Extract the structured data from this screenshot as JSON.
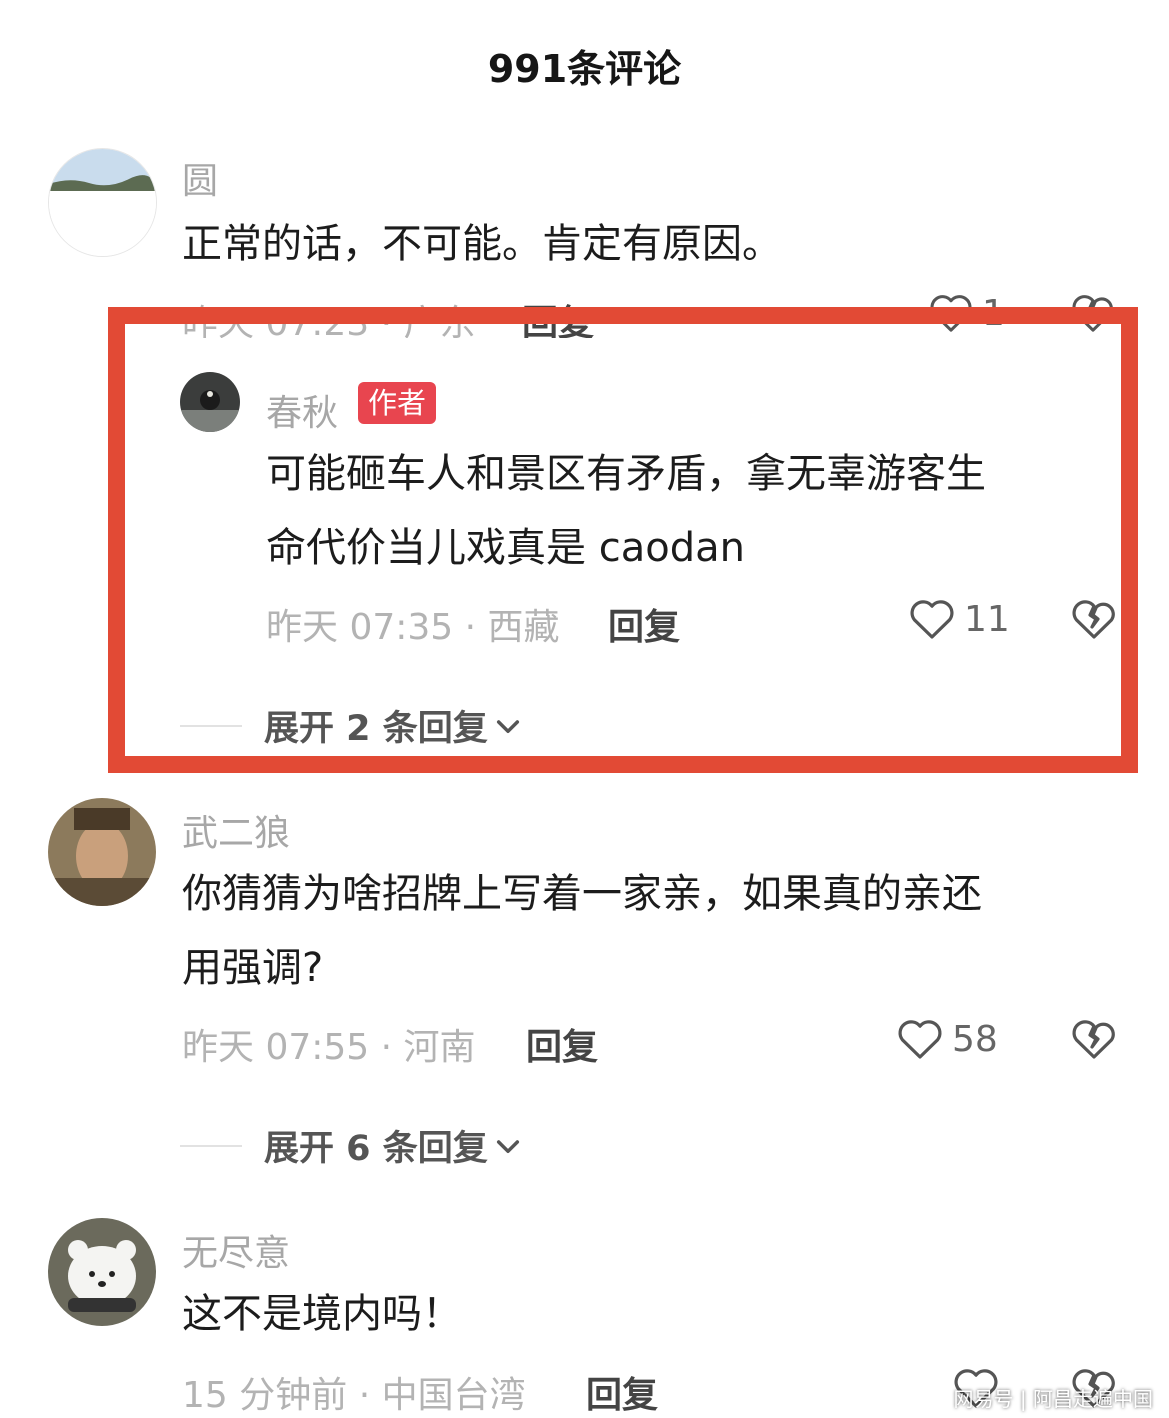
{
  "header": {
    "title": "991条评论"
  },
  "comments": [
    {
      "username": "圆",
      "lines": [
        "正常的话，不可能。肯定有原因。"
      ],
      "meta": "昨天 07:23 · 广东",
      "reply_label": "回复",
      "likes": "1"
    },
    {
      "username": "春秋",
      "badge": "作者",
      "lines": [
        "可能砸车人和景区有矛盾，拿无辜游客生",
        "命代价当儿戏真是 caodan"
      ],
      "meta": "昨天 07:35 · 西藏",
      "reply_label": "回复",
      "likes": "11",
      "expand": "展开 2 条回复"
    },
    {
      "username": "武二狼",
      "lines": [
        "你猜猜为啥招牌上写着一家亲，如果真的亲还",
        "用强调?"
      ],
      "meta": "昨天 07:55 · 河南",
      "reply_label": "回复",
      "likes": "58",
      "expand": "展开 6 条回复"
    },
    {
      "username": "无尽意",
      "lines": [
        "这不是境内吗！"
      ],
      "meta": "15 分钟前 · 中国台湾",
      "reply_label": "回复"
    }
  ],
  "watermark": "网易号 | 阿昌走遍中国",
  "colors": {
    "highlight": "#e24a35",
    "badge": "#e8454f"
  }
}
